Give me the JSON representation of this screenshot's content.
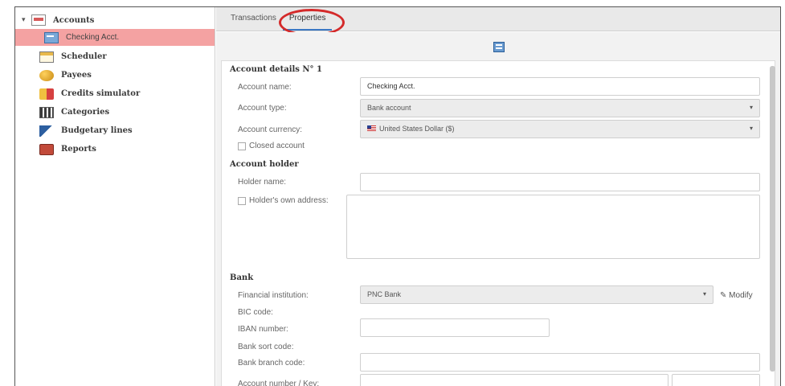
{
  "sidebar": {
    "items": [
      {
        "label": "Accounts",
        "icon": "accounts-icon"
      },
      {
        "label": "Checking Acct.",
        "icon": "checking-icon"
      },
      {
        "label": "Scheduler",
        "icon": "scheduler-icon"
      },
      {
        "label": "Payees",
        "icon": "payees-icon"
      },
      {
        "label": "Credits simulator",
        "icon": "credits-icon"
      },
      {
        "label": "Categories",
        "icon": "categories-icon"
      },
      {
        "label": "Budgetary lines",
        "icon": "budget-icon"
      },
      {
        "label": "Reports",
        "icon": "reports-icon"
      }
    ]
  },
  "tabs": [
    {
      "label": "Transactions"
    },
    {
      "label": "Properties",
      "active": true
    }
  ],
  "details": {
    "section_title": "Account details N° 1",
    "name_label": "Account name:",
    "name_value": "Checking Acct.",
    "type_label": "Account type:",
    "type_value": "Bank account",
    "currency_label": "Account currency:",
    "currency_value": "United States Dollar ($)",
    "closed_label": "Closed account"
  },
  "holder": {
    "section_title": "Account holder",
    "name_label": "Holder name:",
    "name_value": "",
    "address_label": "Holder's own address:"
  },
  "bank": {
    "section_title": "Bank",
    "institution_label": "Financial institution:",
    "institution_value": "PNC Bank",
    "modify_label": "Modify",
    "bic_label": "BIC code:",
    "iban_label": "IBAN number:",
    "iban_value": "",
    "sort_label": "Bank sort code:",
    "branch_label": "Bank branch code:",
    "branch_value": "",
    "account_key_label": "Account number / Key:",
    "account_value": "",
    "key_value": ""
  },
  "colors": {
    "selected_row": "#f4a2a2",
    "highlight_circle": "#d42a2a",
    "active_tab_underline": "#3b78c4"
  }
}
